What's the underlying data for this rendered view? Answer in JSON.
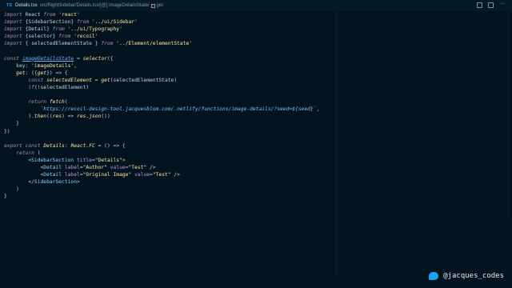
{
  "breadcrumb": {
    "lang_badge": "TS",
    "filename": "Details.tsx",
    "path": "src/RightSidebar/Details.tsx/[@] imageDetailsState/",
    "symbol": "get"
  },
  "code_lines": [
    [
      [
        "kw",
        "import"
      ],
      [
        "pl",
        " React "
      ],
      [
        "kw",
        "from"
      ],
      [
        "str",
        " 'react'"
      ]
    ],
    [
      [
        "kw",
        "import"
      ],
      [
        "pl",
        " {SidebarSection} "
      ],
      [
        "kw",
        "from"
      ],
      [
        "str",
        " '../ui/Sidebar'"
      ]
    ],
    [
      [
        "kw",
        "import"
      ],
      [
        "pl",
        " {Detail} "
      ],
      [
        "kw",
        "from"
      ],
      [
        "str",
        " '../ui/Typography'"
      ]
    ],
    [
      [
        "kw",
        "import"
      ],
      [
        "pl",
        " {selector} "
      ],
      [
        "kw",
        "from"
      ],
      [
        "str",
        " 'recoil'"
      ]
    ],
    [
      [
        "kw",
        "import"
      ],
      [
        "pl",
        " { selectedElementState } "
      ],
      [
        "kw",
        "from"
      ],
      [
        "str",
        " '../Element/elementState'"
      ]
    ],
    [],
    [
      [
        "kw",
        "const"
      ],
      [
        "pl",
        " "
      ],
      [
        "var",
        "imageDetailsState"
      ],
      [
        "pl",
        " = "
      ],
      [
        "fn",
        "selector"
      ],
      [
        "pl",
        "({"
      ]
    ],
    [
      [
        "pl",
        "    key: "
      ],
      [
        "str",
        "'imageDetails'"
      ],
      [
        "pl",
        ","
      ]
    ],
    [
      [
        "pl",
        "    "
      ],
      [
        "fn",
        "get"
      ],
      [
        "pl",
        ": ({"
      ],
      [
        "vari",
        "get"
      ],
      [
        "pl",
        "}) => {"
      ]
    ],
    [
      [
        "pl",
        "        "
      ],
      [
        "kw",
        "const"
      ],
      [
        "pl",
        " "
      ],
      [
        "vari",
        "selectedElement"
      ],
      [
        "pl",
        " = "
      ],
      [
        "fn",
        "get"
      ],
      [
        "pl",
        "(selectedElementState)"
      ]
    ],
    [
      [
        "pl",
        "        "
      ],
      [
        "kw",
        "if"
      ],
      [
        "pl",
        "(!selectedElement)"
      ]
    ],
    [],
    [
      [
        "pl",
        "        "
      ],
      [
        "kw",
        "return"
      ],
      [
        "pl",
        " "
      ],
      [
        "fn",
        "fetch"
      ],
      [
        "pl",
        "("
      ]
    ],
    [
      [
        "pl",
        "            "
      ],
      [
        "strb",
        "`https://recoil-design-tool.jacquesblom.com/.netlify/functions/image-details/?seed=${seed}`"
      ],
      [
        "pl",
        ","
      ]
    ],
    [
      [
        "pl",
        "        )."
      ],
      [
        "fn",
        "then"
      ],
      [
        "pl",
        "(("
      ],
      [
        "vari",
        "res"
      ],
      [
        "pl",
        ") => "
      ],
      [
        "vari",
        "res"
      ],
      [
        "pl",
        "."
      ],
      [
        "fn",
        "json"
      ],
      [
        "pl",
        "())"
      ]
    ],
    [
      [
        "pl",
        "    }"
      ]
    ],
    [
      [
        "pl",
        "})"
      ]
    ],
    [],
    [
      [
        "kw",
        "export"
      ],
      [
        "pl",
        " "
      ],
      [
        "kw",
        "const"
      ],
      [
        "pl",
        " "
      ],
      [
        "vari",
        "Details"
      ],
      [
        "pl",
        ": "
      ],
      [
        "type",
        "React.FC"
      ],
      [
        "pl",
        " = () => {"
      ]
    ],
    [
      [
        "pl",
        "    "
      ],
      [
        "kw",
        "return"
      ],
      [
        "pl",
        " ("
      ]
    ],
    [
      [
        "pl",
        "        <"
      ],
      [
        "tag",
        "SidebarSection"
      ],
      [
        "pl",
        " "
      ],
      [
        "attr",
        "title"
      ],
      [
        "pl",
        "="
      ],
      [
        "str",
        "\"Details\""
      ],
      [
        "pl",
        ">"
      ]
    ],
    [
      [
        "pl",
        "            <"
      ],
      [
        "tag",
        "Detail"
      ],
      [
        "pl",
        " "
      ],
      [
        "attr",
        "label"
      ],
      [
        "pl",
        "="
      ],
      [
        "str",
        "\"Author\""
      ],
      [
        "pl",
        " "
      ],
      [
        "attr",
        "value"
      ],
      [
        "pl",
        "="
      ],
      [
        "str",
        "\"Test\""
      ],
      [
        "pl",
        " />"
      ]
    ],
    [
      [
        "pl",
        "            <"
      ],
      [
        "tag",
        "Detail"
      ],
      [
        "pl",
        " "
      ],
      [
        "attr",
        "label"
      ],
      [
        "pl",
        "="
      ],
      [
        "str",
        "\"Original Image\""
      ],
      [
        "pl",
        " "
      ],
      [
        "attr",
        "value"
      ],
      [
        "pl",
        "="
      ],
      [
        "str",
        "\"Test\""
      ],
      [
        "pl",
        " />"
      ]
    ],
    [
      [
        "pl",
        "        </"
      ],
      [
        "tag",
        "SidebarSection"
      ],
      [
        "pl",
        ">"
      ]
    ],
    [
      [
        "pl",
        "    )"
      ]
    ],
    [
      [
        "pl",
        "}"
      ]
    ]
  ],
  "watermark": {
    "handle": "@jacques_codes"
  }
}
